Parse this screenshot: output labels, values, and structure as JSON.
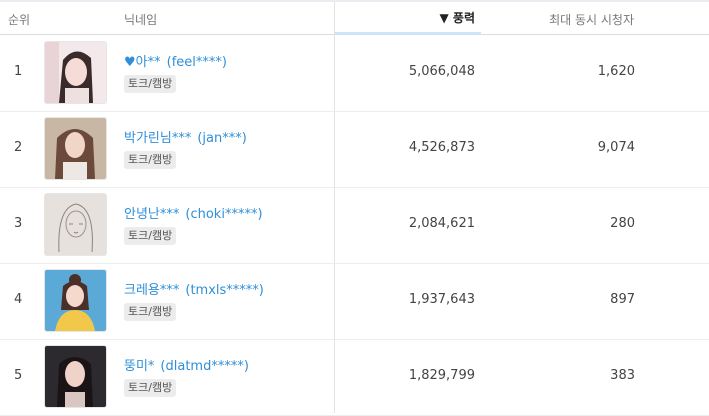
{
  "header": {
    "rank": "순위",
    "nickname": "닉네임",
    "power": "▼ 풍력",
    "viewers": "최대 동시 시청자"
  },
  "rows": [
    {
      "rank": "1",
      "nick": "♥아**",
      "id": "(feel****)",
      "tag": "토크/캠방",
      "power": "5,066,048",
      "viewers": "1,620"
    },
    {
      "rank": "2",
      "nick": "박가린님***",
      "id": "(jan***)",
      "tag": "토크/캠방",
      "power": "4,526,873",
      "viewers": "9,074"
    },
    {
      "rank": "3",
      "nick": "안녕난***",
      "id": "(choki*****)",
      "tag": "토크/캠방",
      "power": "2,084,621",
      "viewers": "280"
    },
    {
      "rank": "4",
      "nick": "크레용***",
      "id": "(tmxls*****)",
      "tag": "토크/캠방",
      "power": "1,937,643",
      "viewers": "897"
    },
    {
      "rank": "5",
      "nick": "뚱미*",
      "id": "(dlatmd*****)",
      "tag": "토크/캠방",
      "power": "1,829,799",
      "viewers": "383"
    }
  ],
  "colors": {
    "link": "#2f8fd8",
    "sort_underline": "#cfe5f7",
    "tag_bg": "#ececec"
  }
}
